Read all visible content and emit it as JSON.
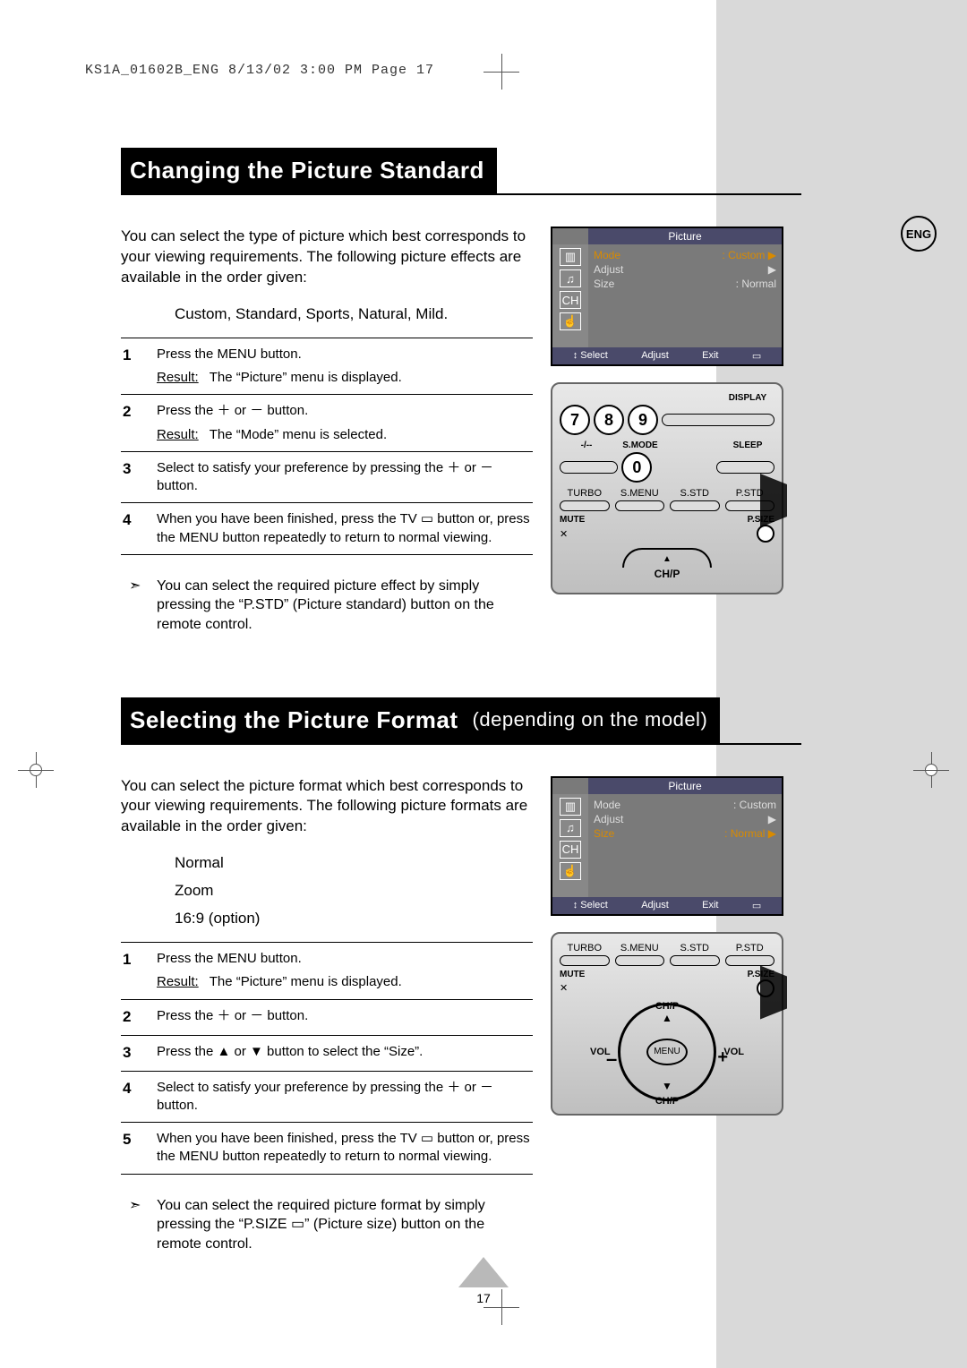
{
  "header_line": "KS1A_01602B_ENG  8/13/02  3:00 PM  Page 17",
  "eng_badge": "ENG",
  "page_number": "17",
  "section1": {
    "title": "Changing the Picture Standard",
    "intro": "You can select the type of picture which best corresponds to your viewing requirements. The following picture effects are available in the order given:",
    "options": "Custom, Standard, Sports, Natural, Mild.",
    "steps": [
      {
        "n": "1",
        "text": "Press the MENU button.",
        "result": "The “Picture” menu is displayed."
      },
      {
        "n": "2",
        "text": "Press the ＋ or － button.",
        "result": "The “Mode” menu is selected."
      },
      {
        "n": "3",
        "text": "Select to satisfy your preference by pressing the ＋ or － button."
      },
      {
        "n": "4",
        "text": "When you have been finished, press the TV ▭ button or, press the MENU button repeatedly to return to normal viewing."
      }
    ],
    "tip": "You can select the required picture effect by simply pressing the “P.STD” (Picture standard) button on the remote control.",
    "osd": {
      "title": "Picture",
      "rows": [
        {
          "k": "Mode",
          "v": ": Custom",
          "hl": true,
          "arrow": "▶"
        },
        {
          "k": "Adjust",
          "v": "▶"
        },
        {
          "k": "Size",
          "v": ": Normal"
        }
      ],
      "footer": [
        "↕ Select",
        "Adjust",
        "Exit",
        "▭"
      ]
    }
  },
  "section2": {
    "title": "Selecting the Picture Format",
    "title_extra": "(depending on the model)",
    "intro": "You can select the picture format which best corresponds to your viewing requirements. The following picture formats are available in the order given:",
    "options": [
      "Normal",
      "Zoom",
      "16:9 (option)"
    ],
    "steps": [
      {
        "n": "1",
        "text": "Press the MENU button.",
        "result": "The “Picture” menu is displayed."
      },
      {
        "n": "2",
        "text": "Press the ＋ or － button."
      },
      {
        "n": "3",
        "text": "Press the ▲ or ▼ button to select the “Size”."
      },
      {
        "n": "4",
        "text": "Select to satisfy your preference by pressing the ＋ or － button."
      },
      {
        "n": "5",
        "text": "When you have been finished, press the TV ▭ button or, press the MENU button repeatedly to return to normal viewing."
      }
    ],
    "tip": "You can select the required picture format by simply pressing the “P.SIZE ▭” (Picture size) button on the remote control.",
    "osd": {
      "title": "Picture",
      "rows": [
        {
          "k": "Mode",
          "v": ": Custom"
        },
        {
          "k": "Adjust",
          "v": "▶"
        },
        {
          "k": "Size",
          "v": ": Normal",
          "hl": true,
          "arrow": "▶"
        }
      ],
      "footer": [
        "↕ Select",
        "Adjust",
        "Exit",
        "▭"
      ]
    }
  },
  "remote1": {
    "display": "DISPLAY",
    "nums": [
      "7",
      "8",
      "9"
    ],
    "minus_slash": "-/--",
    "smode": "S.MODE",
    "zero": "0",
    "sleep": "SLEEP",
    "row_labels": [
      "TURBO",
      "S.MENU",
      "S.STD",
      "P.STD"
    ],
    "mute": "MUTE",
    "psize": "P.SIZE",
    "chp": "CH/P"
  },
  "remote2": {
    "row_labels": [
      "TURBO",
      "S.MENU",
      "S.STD",
      "P.STD"
    ],
    "mute": "MUTE",
    "psize": "P.SIZE",
    "menu": "MENU",
    "vol": "VOL",
    "chp": "CH/P"
  },
  "result_label": "Result:"
}
